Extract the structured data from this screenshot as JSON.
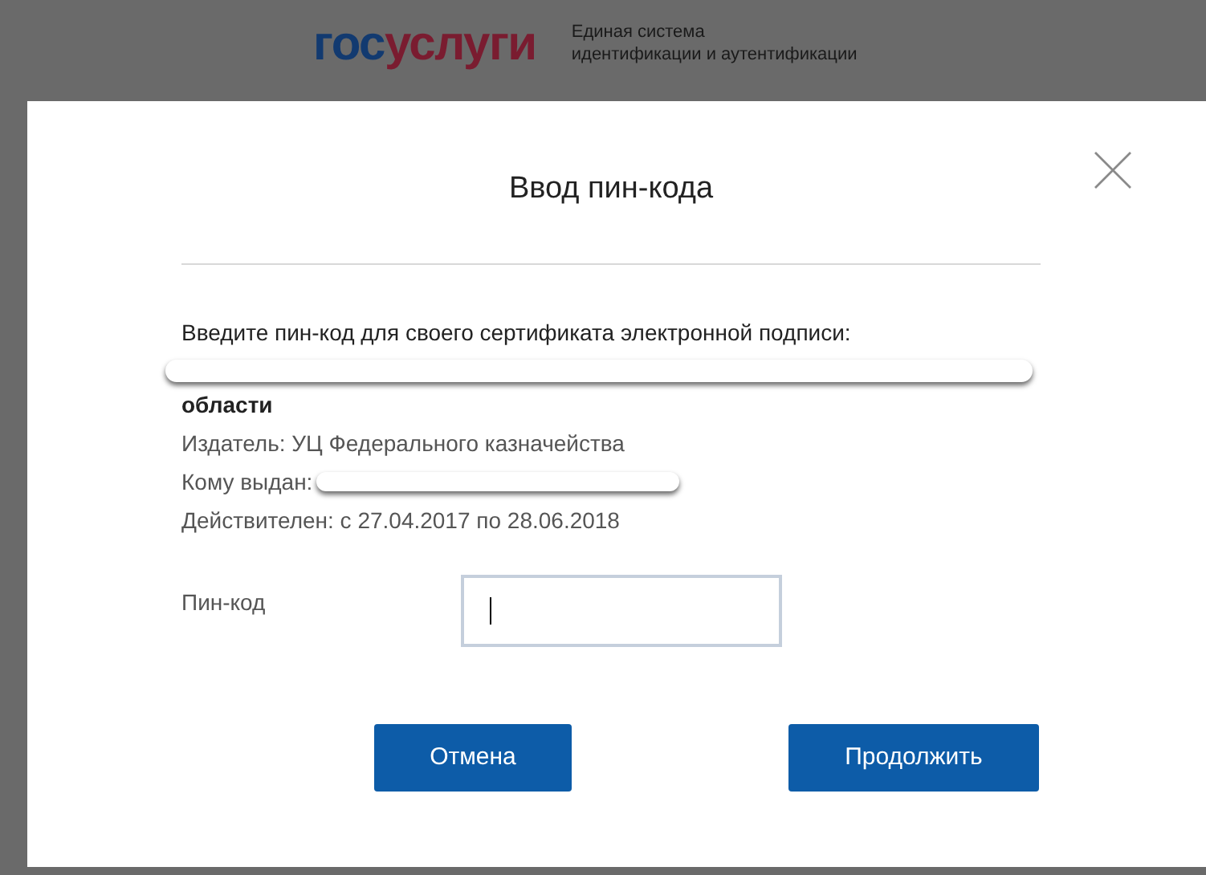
{
  "header": {
    "logo_parts": [
      {
        "text": "гос",
        "color": "#123a70"
      },
      {
        "text": "услуги",
        "color": "#7a1c30"
      }
    ],
    "tagline": [
      "Единая система",
      "идентификации и аутентификации"
    ]
  },
  "dialog": {
    "title": "Ввод пин-кода",
    "prompt": "Введите пин-код для своего сертификата электронной подписи:",
    "owner_tail": "области",
    "issuer": "Издатель: УЦ Федерального казначейства",
    "issued_to_label": "Кому выдан:",
    "validity": "Действителен: с 27.04.2017 по 28.06.2018",
    "pin_label": "Пин-код",
    "pin_field": {
      "focused": true
    },
    "buttons": [
      {
        "label": "Отмена"
      },
      {
        "label": "Продолжить"
      }
    ]
  }
}
